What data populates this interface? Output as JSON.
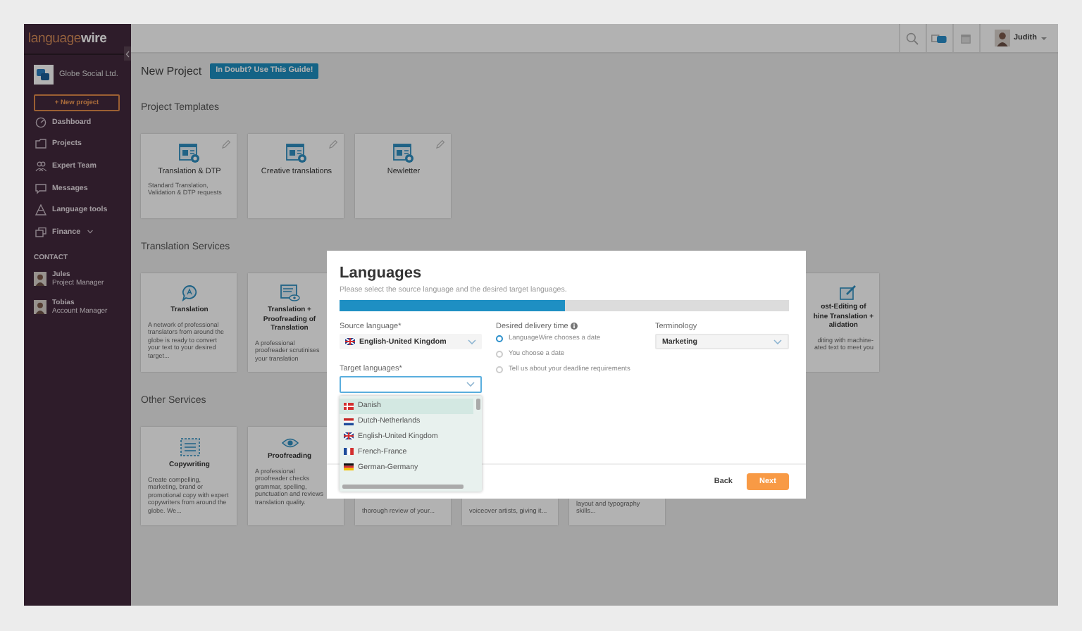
{
  "sidebar": {
    "logo": "language**wire**",
    "company": "Globe Social Ltd.",
    "new_project": "+ New project",
    "items": [
      {
        "label": "Dashboard",
        "dropdown": false
      },
      {
        "label": "Projects",
        "dropdown": false
      },
      {
        "label": "Expert Team",
        "dropdown": false
      },
      {
        "label": "Messages",
        "dropdown": false
      },
      {
        "label": "Language tools",
        "dropdown": false
      },
      {
        "label": "Finance",
        "dropdown": true
      }
    ],
    "contact": {
      "heading": "CONTACT",
      "people": [
        {
          "name": "Jules",
          "role": "Project Manager"
        },
        {
          "name": "Tobias",
          "role": "Account Manager"
        }
      ]
    }
  },
  "topbar": {
    "user": "Judith"
  },
  "page": {
    "title": "New Project",
    "guide_button": "In Doubt? Use This Guide!",
    "sections": [
      {
        "heading": "Project Templates",
        "cards": [
          {
            "kind": "template",
            "title": "Translation & DTP",
            "desc": "Standard Translation, Validation & DTP requests"
          },
          {
            "kind": "template",
            "title": "Creative translations"
          },
          {
            "kind": "template",
            "title": "Newletter"
          }
        ]
      },
      {
        "heading": "Translation Services",
        "cards": [
          {
            "kind": "service",
            "title": "Translation",
            "desc": "A network of professional translators from around the globe is ready to convert your text to your desired target..."
          },
          {
            "kind": "service",
            "title": "Translation + Proofreading of Translation",
            "desc": "A professional proofreader scrutinises your translation"
          },
          {
            "kind": "partial",
            "title": "ost-Editing of\nhine Translation +\nalidation",
            "desc": "diting with machine-\nated text to meet you"
          }
        ]
      },
      {
        "heading": "Other Services",
        "cards": [
          {
            "kind": "service",
            "title": "Copywriting",
            "desc": "Create compelling, marketing, brand or promotional copy with expert copywriters from around the globe. We..."
          },
          {
            "kind": "service",
            "title": "Proofreading",
            "desc": "A professional proofreader checks grammar, spelling, punctuation and reviews translation quality."
          },
          {
            "kind": "tail",
            "desc": "thorough review of your..."
          },
          {
            "kind": "tail",
            "desc": "voiceover artists, giving it..."
          },
          {
            "kind": "tail",
            "desc": "layout and typography skills..."
          }
        ]
      }
    ]
  },
  "modal": {
    "title": "Languages",
    "subtitle": "Please select the source language and the desired target languages.",
    "level": 0.5,
    "source": {
      "label": "Source language*",
      "value": "English-United Kingdom",
      "kind": "gb"
    },
    "target": {
      "label": "Target languages*",
      "focused": true,
      "options": [
        {
          "label": "Danish",
          "kind": "dk",
          "selected": true
        },
        {
          "label": "Dutch-Netherlands",
          "kind": "nl",
          "selected": false
        },
        {
          "label": "English-United Kingdom",
          "kind": "gb",
          "selected": false
        },
        {
          "label": "French-France",
          "kind": "fr",
          "selected": false
        },
        {
          "label": "German-Germany",
          "kind": "de",
          "selected": false
        }
      ]
    },
    "delivery": {
      "label": "Desired delivery time",
      "options": [
        {
          "label": "LanguageWire chooses a date",
          "selected": true
        },
        {
          "label": "You choose a date",
          "selected": false
        },
        {
          "label": "Tell us about your deadline requirements",
          "selected": false
        }
      ]
    },
    "terminology": {
      "label": "Terminology",
      "value": "Marketing"
    },
    "buttons": {
      "back": "Back",
      "next": "Next"
    }
  }
}
